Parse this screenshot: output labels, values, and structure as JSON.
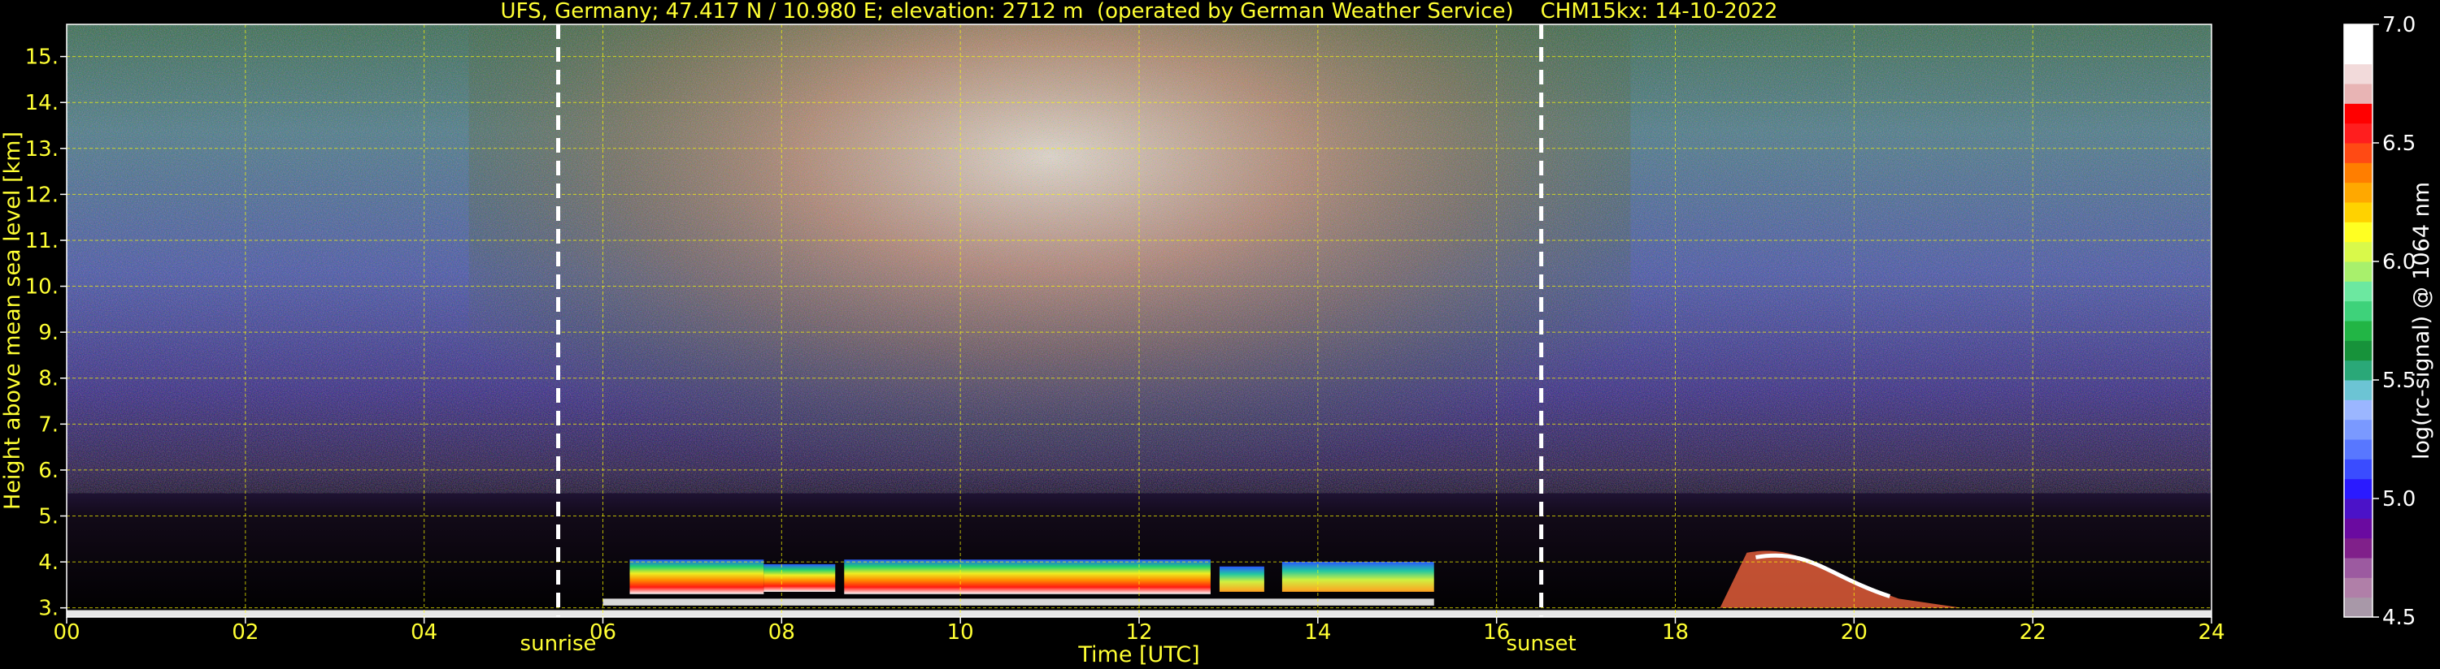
{
  "chart_data": {
    "type": "heatmap",
    "title": "UFS, Germany; 47.417 N / 10.980 E; elevation: 2712 m  (operated by German Weather Service)    CHM15kx: 14-10-2022",
    "xlabel": "Time [UTC]",
    "ylabel": "Height above mean sea level [km]",
    "xlim": [
      0,
      24
    ],
    "ylim": [
      2.8,
      15.7
    ],
    "x_ticks": [
      "00",
      "02",
      "04",
      "06",
      "08",
      "10",
      "12",
      "14",
      "16",
      "18",
      "20",
      "22",
      "24"
    ],
    "x_tick_values": [
      0,
      2,
      4,
      6,
      8,
      10,
      12,
      14,
      16,
      18,
      20,
      22,
      24
    ],
    "y_ticks": [
      "3.",
      "4.",
      "5.",
      "6.",
      "7.",
      "8.",
      "9.",
      "10.",
      "11.",
      "12.",
      "13.",
      "14.",
      "15."
    ],
    "y_tick_values": [
      3,
      4,
      5,
      6,
      7,
      8,
      9,
      10,
      11,
      12,
      13,
      14,
      15
    ],
    "grid": true,
    "grid_color": "#ffff00",
    "markers": [
      {
        "label": "sunrise",
        "x": 5.5
      },
      {
        "label": "sunset",
        "x": 16.5
      }
    ],
    "colorbar": {
      "label": "log(rc-signal) @ 1064 nm",
      "min": 4.5,
      "max": 7.0,
      "ticks": [
        "4.5",
        "5.0",
        "5.5",
        "6.0",
        "6.5",
        "7.0"
      ],
      "tick_values": [
        4.5,
        5.0,
        5.5,
        6.0,
        6.5,
        7.0
      ],
      "colors": [
        "#a898a8",
        "#b07fa8",
        "#9c5aa0",
        "#80208a",
        "#6a0aa0",
        "#4b12c8",
        "#2a1aff",
        "#3a4cff",
        "#5877ff",
        "#7a99ff",
        "#9bb6ff",
        "#6cc4d4",
        "#2aa878",
        "#17923a",
        "#22b545",
        "#3ed27a",
        "#6ce8a0",
        "#a8f06c",
        "#d9f94a",
        "#ffff22",
        "#ffd200",
        "#ffa800",
        "#ff7e00",
        "#ff4a14",
        "#ff1e1e",
        "#ff0000",
        "#e8b4b4",
        "#f2dada",
        "#ffffff",
        "#ffffff"
      ]
    },
    "regions": [
      {
        "label": "boundary layer aerosol",
        "x_range": [
          6.3,
          15.3
        ],
        "y_range": [
          3.3,
          4.0
        ]
      },
      {
        "label": "surface signal",
        "x_range": [
          0,
          24
        ],
        "y_range": [
          2.8,
          3.0
        ]
      },
      {
        "label": "evening aerosol / cloud feature",
        "x_range": [
          18.8,
          20.5
        ],
        "y_range": [
          3.0,
          4.3
        ]
      }
    ]
  }
}
